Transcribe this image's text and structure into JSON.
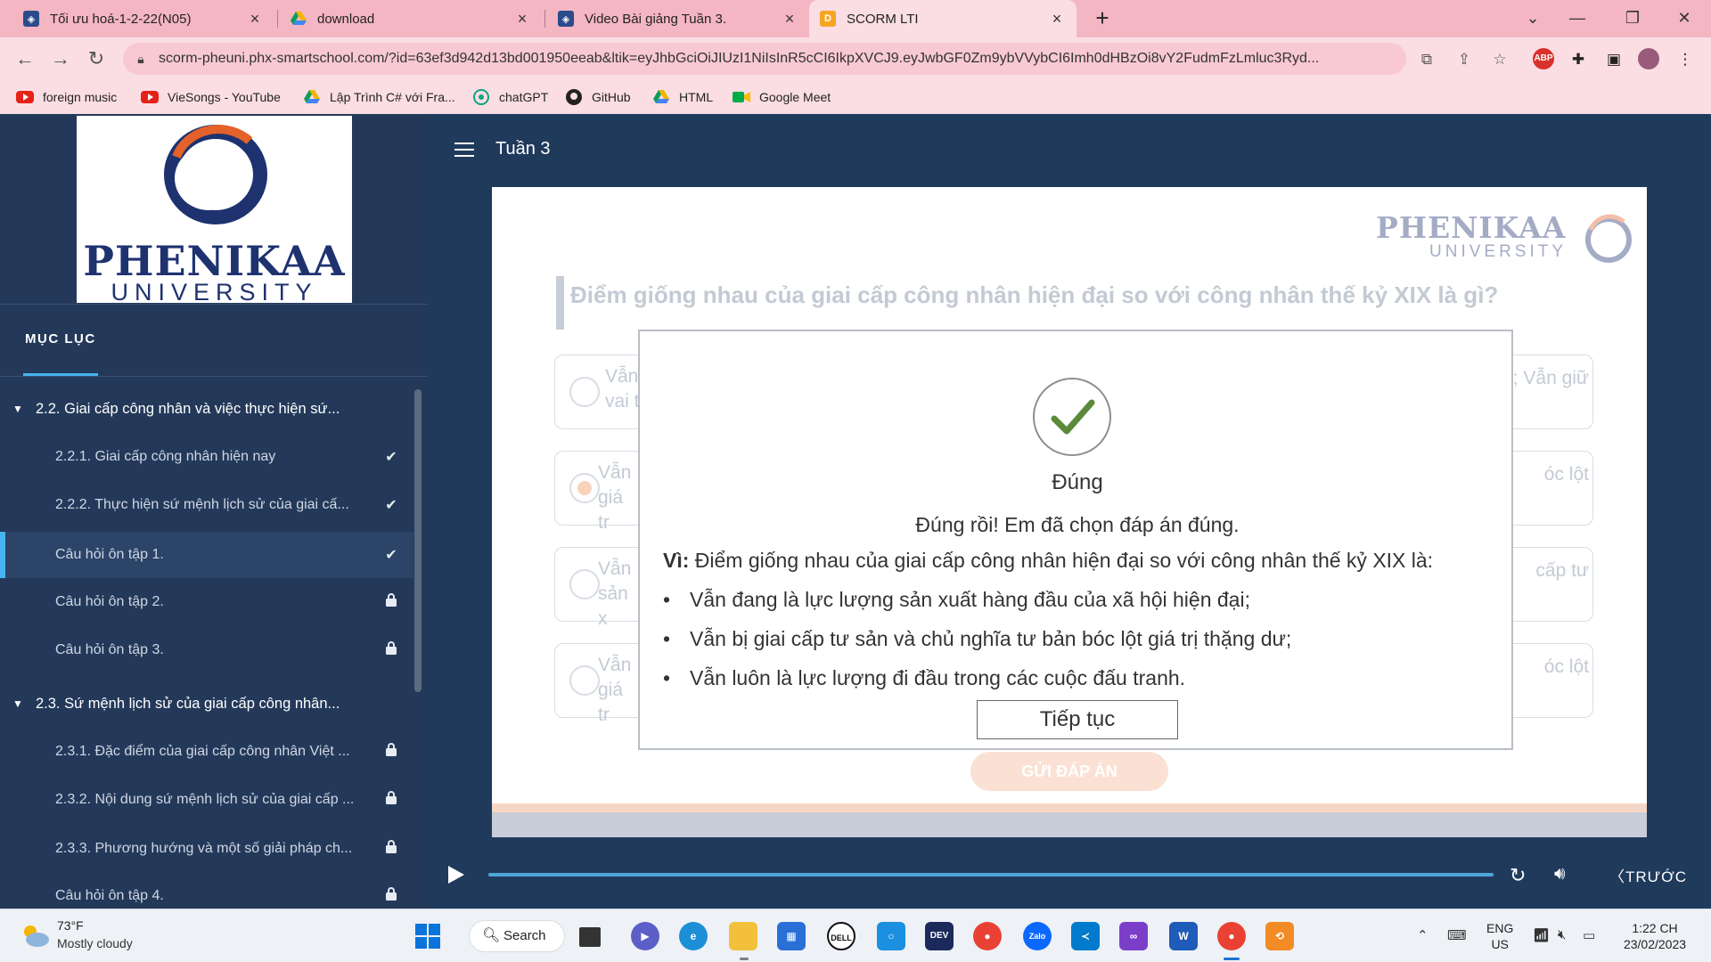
{
  "browser": {
    "tabs": [
      {
        "title": "Tối ưu hoá-1-2-22(N05)",
        "icon": "university-icon",
        "active": false
      },
      {
        "title": "download",
        "icon": "google-drive-icon",
        "active": false
      },
      {
        "title": "Video Bài giảng Tuần 3.",
        "icon": "university-icon",
        "active": false
      },
      {
        "title": "SCORM LTI",
        "icon": "scorm-d-icon",
        "active": true
      }
    ],
    "url": "scorm-pheuni.phx-smartschool.com/?id=63ef3d942d13bd001950eeab&ltik=eyJhbGciOiJIUzI1NiIsInR5cCI6IkpXVCJ9.eyJwbGF0Zm9ybVVybCI6Imh0dHBzOi8vY2FudmFzLmluc3Ryd...",
    "bookmarks": [
      {
        "label": "foreign music",
        "icon": "youtube-icon"
      },
      {
        "label": "VieSongs - YouTube",
        "icon": "youtube-icon"
      },
      {
        "label": "Lập Trình C# với Fra...",
        "icon": "google-drive-icon"
      },
      {
        "label": "chatGPT",
        "icon": "openai-icon"
      },
      {
        "label": "GitHub",
        "icon": "github-icon"
      },
      {
        "label": "HTML",
        "icon": "google-drive-icon"
      },
      {
        "label": "Google Meet",
        "icon": "google-meet-icon"
      }
    ],
    "ext_abp": "ABP"
  },
  "sidebar": {
    "logo_name": "PHENIKAA",
    "logo_uni": "UNIVERSITY",
    "toc_title": "MỤC LỤC",
    "rows": [
      {
        "type": "section",
        "label": "2.2. Giai cấp công nhân và việc thực hiện sứ...",
        "status": ""
      },
      {
        "type": "item",
        "label": "2.2.1. Giai cấp công nhân hiện nay",
        "status": "done"
      },
      {
        "type": "item",
        "label": "2.2.2. Thực hiện sứ mệnh lịch sử của giai cấ...",
        "status": "done"
      },
      {
        "type": "item",
        "label": "Câu hỏi ôn tập 1.",
        "status": "done",
        "active": true
      },
      {
        "type": "item",
        "label": "Câu hỏi ôn tập 2.",
        "status": "locked"
      },
      {
        "type": "item",
        "label": "Câu hỏi ôn tập 3.",
        "status": "locked"
      },
      {
        "type": "section",
        "label": "2.3. Sứ mệnh lịch sử của giai cấp công nhân...",
        "status": ""
      },
      {
        "type": "item",
        "label": "2.3.1. Đặc điểm của giai cấp công nhân Việt ...",
        "status": "locked"
      },
      {
        "type": "item",
        "label": "2.3.2. Nội dung sứ mệnh lịch sử của giai cấp ...",
        "status": "locked"
      },
      {
        "type": "item",
        "label": "2.3.3. Phương hướng và một số giải pháp ch...",
        "status": "locked"
      },
      {
        "type": "item",
        "label": "Câu hỏi ôn tập 4.",
        "status": "locked"
      }
    ]
  },
  "player": {
    "title": "Tuần 3",
    "slide_logo_name": "PHENIKAA",
    "slide_logo_uni": "UNIVERSITY",
    "question": "Điểm giống nhau của giai cấp công nhân hiện đại so với công nhân thế kỷ XIX là gì?",
    "options": [
      {
        "left": "Vẫn vai t",
        "right": "; Vẫn giữ",
        "selected": false
      },
      {
        "left": "Vẫn giá tr",
        "right": "óc lột",
        "selected": true
      },
      {
        "left": "Vẫn sản x",
        "right": "cấp tư",
        "selected": false
      },
      {
        "left": "Vẫn giá tr",
        "right": "óc lột",
        "selected": false
      }
    ],
    "submit_label": "GỬI ĐÁP ÁN",
    "prev_label": "TRƯỚC"
  },
  "feedback": {
    "title": "Đúng",
    "message": "Đúng rồi! Em đã chọn đáp án đúng.",
    "reason_prefix": "Vì:",
    "reason_text": " Điểm giống nhau của giai cấp công nhân hiện đại so với công nhân thế kỷ XIX là:",
    "bullets": [
      "Vẫn đang là lực lượng sản xuất hàng đầu của xã hội hiện đại;",
      "Vẫn bị giai cấp tư sản và chủ nghĩa tư bản bóc lột giá trị thặng dư;",
      "Vẫn luôn là lực lượng đi đầu trong các cuộc đấu tranh."
    ],
    "continue_label": "Tiếp tục"
  },
  "taskbar": {
    "temperature": "73°F",
    "weather": "Mostly cloudy",
    "search_label": "Search",
    "lang_top": "ENG",
    "lang_bottom": "US",
    "time": "1:22 CH",
    "date": "23/02/2023"
  },
  "colors": {
    "tab_bg": "#f4b6c2",
    "chrome_bg": "#fbdde4",
    "sidebar_bg": "#24395a",
    "page_bg": "#203a5c",
    "accent": "#46b4f0",
    "logo_blue": "#1e3270",
    "logo_orange": "#e2622a",
    "correct_green": "#5b8a3a"
  }
}
